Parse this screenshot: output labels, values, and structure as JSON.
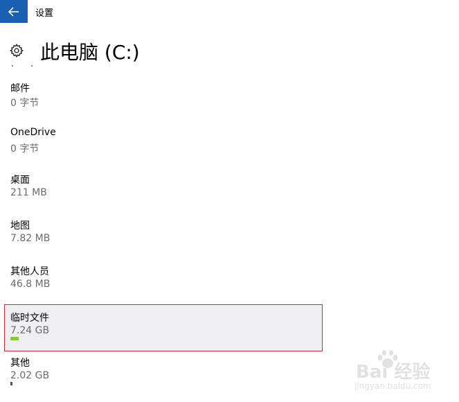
{
  "titlebar": {
    "back_icon": "back-arrow-icon",
    "app_title": "设置",
    "accent_color": "#1a60b0"
  },
  "header": {
    "icon": "gear-icon",
    "title": "此电脑 (C:)"
  },
  "storage_items": [
    {
      "label": "邮件",
      "value": "0 字节",
      "usage_fraction": 0
    },
    {
      "label": "OneDrive",
      "value": "0 字节",
      "usage_fraction": 0
    },
    {
      "label": "桌面",
      "value": "211 MB",
      "usage_fraction": 0
    },
    {
      "label": "地图",
      "value": "7.82 MB",
      "usage_fraction": 0
    },
    {
      "label": "其他人员",
      "value": "46.8 MB",
      "usage_fraction": 0
    },
    {
      "label": "临时文件",
      "value": "7.24 GB",
      "usage_fraction": 0.06,
      "selected": true,
      "bar_color": "#8cc63f"
    },
    {
      "label": "其他",
      "value": "2.02 GB",
      "usage_fraction": 0.015,
      "bar_color": "#555555"
    }
  ],
  "selection_highlight_color": "#cf2a2f",
  "watermark": {
    "brand": "Bai 经验",
    "url": "jingyan.baidu.com"
  }
}
